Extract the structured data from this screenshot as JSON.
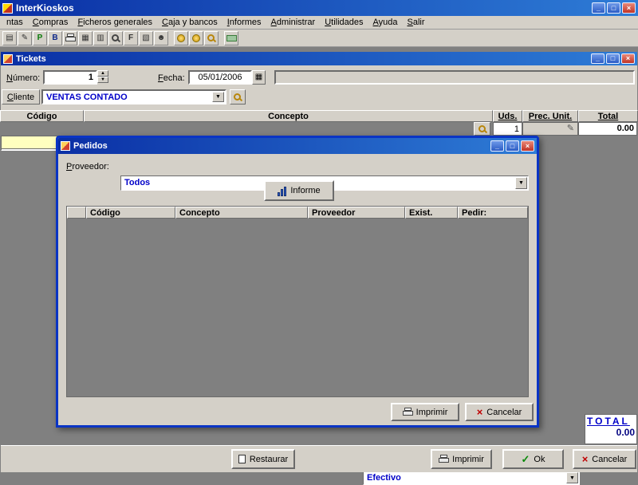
{
  "colors": {
    "titlebar_start": "#0a2fa5",
    "titlebar_end": "#2e7cd6",
    "window_bg": "#d4d0c8",
    "mdi_bg": "#808080",
    "accent_blue_text": "#0000c8",
    "highlight_yellow": "#ffffbf",
    "close_red": "#c13325",
    "ok_green": "#0a8a0a"
  },
  "icons": {
    "minimize": "_",
    "maximize": "□",
    "close": "×",
    "dropdown_arrow": "▼",
    "spinner_up": "▲",
    "spinner_down": "▼",
    "calendar": "▦",
    "check": "✓",
    "cross": "×",
    "pen": "✎"
  },
  "main_window": {
    "title": "InterKioskos"
  },
  "menubar": {
    "items": [
      "ntas",
      "Compras",
      "Ficheros generales",
      "Caja y bancos",
      "Informes",
      "Administrar",
      "Utilidades",
      "Ayuda",
      "Salir"
    ]
  },
  "toolbar": {
    "icons": [
      {
        "name": "ticket-icon",
        "glyph": "▤"
      },
      {
        "name": "edit-document-icon",
        "glyph": "✎"
      },
      {
        "name": "products-icon",
        "glyph": "P"
      },
      {
        "name": "barcode-icon",
        "glyph": "B"
      },
      {
        "name": "printer-icon",
        "glyph": ""
      },
      {
        "name": "calculator-icon",
        "glyph": "▦"
      },
      {
        "name": "notes-icon",
        "glyph": "▥"
      },
      {
        "name": "search-icon",
        "glyph": ""
      },
      {
        "name": "invoices-icon",
        "glyph": "F"
      },
      {
        "name": "reports-icon",
        "glyph": "▧"
      },
      {
        "name": "clients-icon",
        "glyph": "☻"
      },
      {
        "name": "coin-icon",
        "glyph": ""
      },
      {
        "name": "coin2-icon",
        "glyph": ""
      },
      {
        "name": "zoom-icon",
        "glyph": ""
      },
      {
        "name": "money-icon",
        "glyph": ""
      }
    ]
  },
  "tickets": {
    "title": "Tickets",
    "fields": {
      "numero_label": "Número:",
      "numero_value": "1",
      "fecha_label": "Fecha:",
      "fecha_value": "05/01/2006",
      "cliente_label": "Cliente",
      "cliente_value": "VENTAS CONTADO"
    },
    "grid": {
      "columns": [
        "Código",
        "Concepto",
        "Uds.",
        "Prec. Unit.",
        "Total"
      ],
      "entry_uds": "1",
      "entry_total": "0.00"
    },
    "footer": {
      "payment_method": "Efectivo",
      "total_label": "TOTAL",
      "total_value": "0.00",
      "restaurar": "Restaurar",
      "imprimir": "Imprimir",
      "ok": "Ok",
      "cancelar": "Cancelar"
    }
  },
  "pedidos": {
    "title": "Pedidos",
    "proveedor_label": "Proveedor:",
    "proveedor_value": "Todos",
    "informe": "Informe",
    "columns": [
      "Código",
      "Concepto",
      "Proveedor",
      "Exist.",
      "Pedir:"
    ],
    "imprimir": "Imprimir",
    "cancelar": "Cancelar"
  }
}
